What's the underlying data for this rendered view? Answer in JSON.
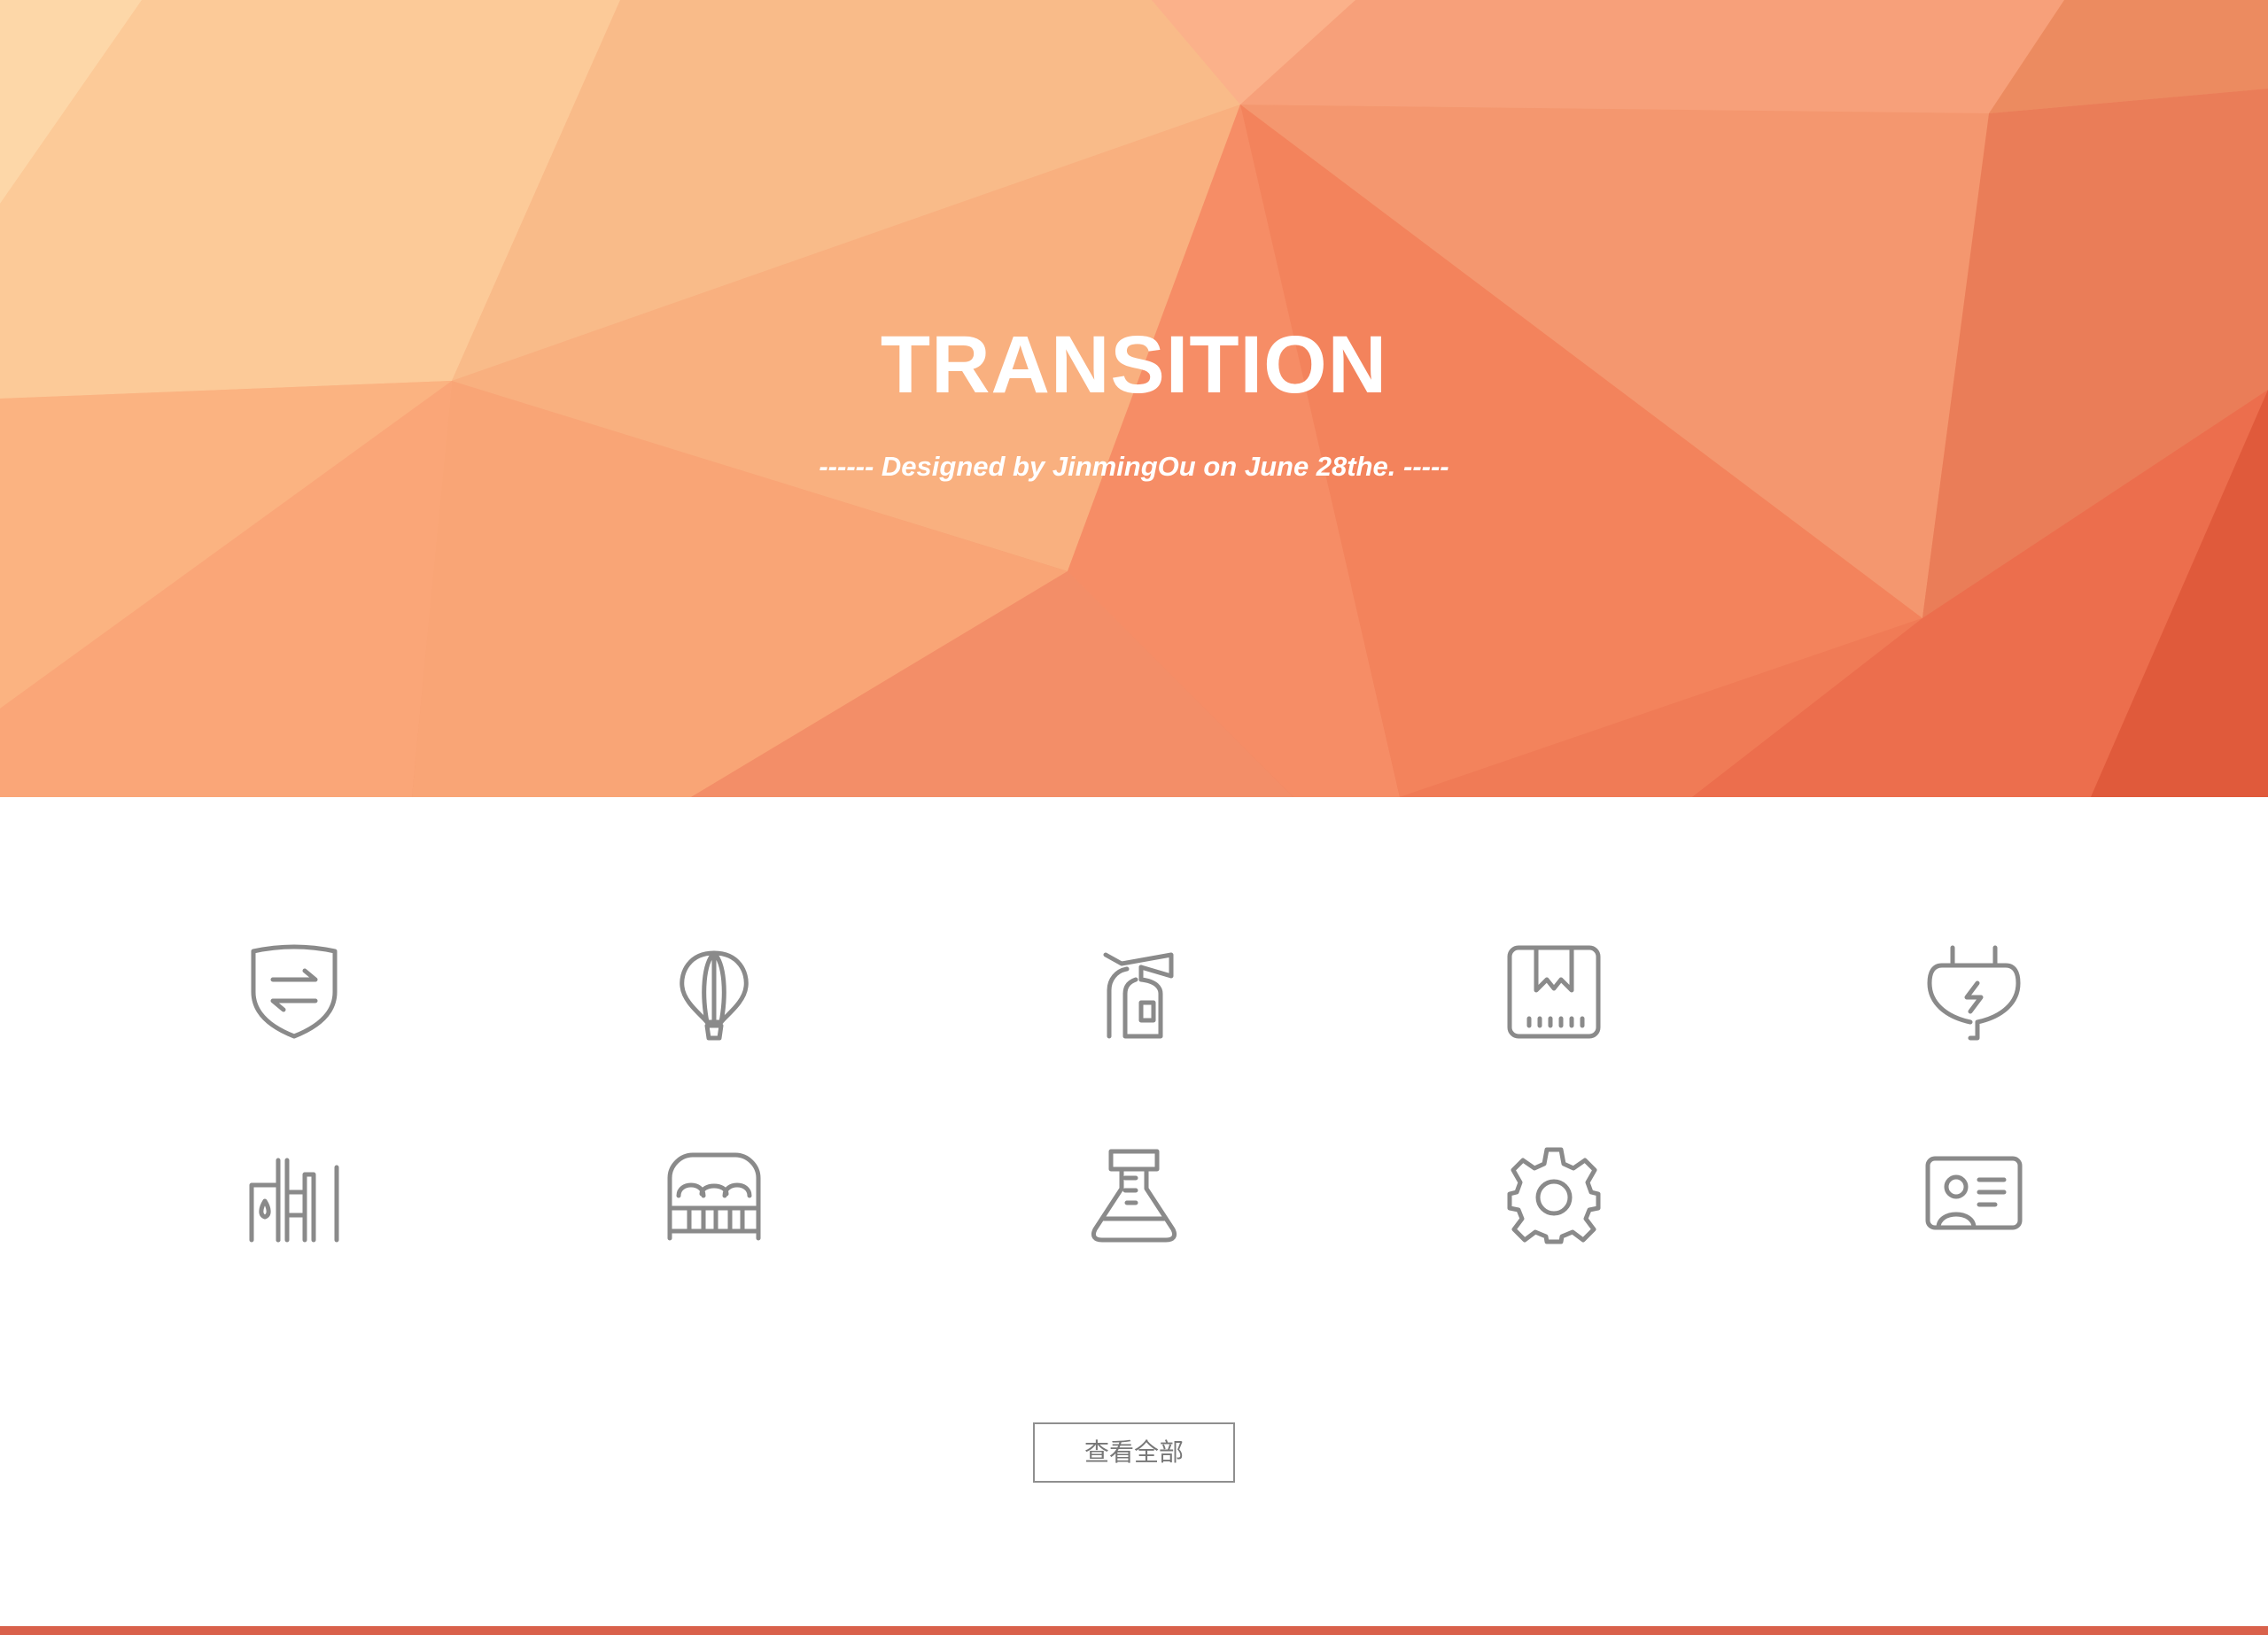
{
  "hero": {
    "title": "TRANSITION",
    "subtitle": "------ Designed by JinmingOu on June 28the. -----"
  },
  "icons": [
    {
      "name": "shield-transfer-icon"
    },
    {
      "name": "hot-air-balloon-icon"
    },
    {
      "name": "fire-extinguisher-icon"
    },
    {
      "name": "package-box-icon"
    },
    {
      "name": "power-plug-icon"
    },
    {
      "name": "factory-icon"
    },
    {
      "name": "bed-icon"
    },
    {
      "name": "lab-flask-icon"
    },
    {
      "name": "gear-icon"
    },
    {
      "name": "id-card-icon"
    }
  ],
  "actions": {
    "view_all_label": "查看全部"
  },
  "colors": {
    "hero_light": "#fcd0a0",
    "hero_mid": "#f7a37a",
    "hero_dark": "#e05a3c",
    "icon_stroke": "#8a8a8a",
    "bottom_bar": "#d9614b"
  }
}
